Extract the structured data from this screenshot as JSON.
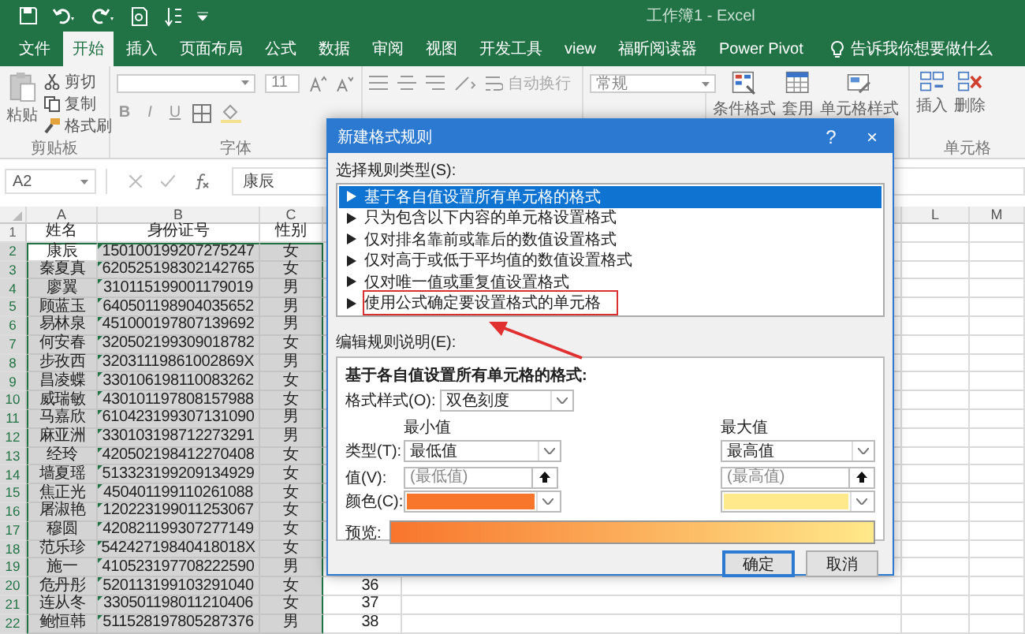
{
  "window": {
    "title": "工作簿1  -  Excel"
  },
  "menu_tabs": [
    {
      "label": "文件",
      "selected": false
    },
    {
      "label": "开始",
      "selected": true
    },
    {
      "label": "插入",
      "selected": false
    },
    {
      "label": "页面布局",
      "selected": false
    },
    {
      "label": "公式",
      "selected": false
    },
    {
      "label": "数据",
      "selected": false
    },
    {
      "label": "审阅",
      "selected": false
    },
    {
      "label": "视图",
      "selected": false
    },
    {
      "label": "开发工具",
      "selected": false
    },
    {
      "label": "view",
      "selected": false
    },
    {
      "label": "福昕阅读器",
      "selected": false
    },
    {
      "label": "Power Pivot",
      "selected": false
    }
  ],
  "tell_me": "告诉我你想要做什么",
  "ribbon": {
    "clipboard": {
      "paste": "粘贴",
      "cut": "剪切",
      "copy": "复制",
      "format_painter": "格式刷",
      "label": "剪贴板"
    },
    "font": {
      "size": "11",
      "bold": "B",
      "italic": "I",
      "underline": "U",
      "label": "字体"
    },
    "alignment": {
      "wrap_text": "自动换行"
    },
    "number": {
      "format": "常规"
    },
    "styles": {
      "conditional_formatting": "条件格式",
      "format_as_table": "套用",
      "cell_styles": "单元格样式"
    },
    "cells": {
      "insert": "插入",
      "delete": "删除",
      "label": "单元格"
    }
  },
  "formula_bar": {
    "name_box": "A2",
    "value": "康辰"
  },
  "sheet": {
    "column_headers": [
      "A",
      "B",
      "C",
      "L",
      "M"
    ],
    "rows": [
      {
        "number": "1",
        "cells": [
          "姓名",
          "身份证号",
          "性别"
        ],
        "selected": false,
        "active": false
      },
      {
        "number": "2",
        "cells": [
          "康辰",
          "150100199207275247",
          "女"
        ],
        "selected": true,
        "active": true
      },
      {
        "number": "3",
        "cells": [
          "秦夏真",
          "620525198302142765",
          "女"
        ],
        "selected": true,
        "active": false
      },
      {
        "number": "4",
        "cells": [
          "廖翼",
          "310115199001179019",
          "男"
        ],
        "selected": true,
        "active": false
      },
      {
        "number": "5",
        "cells": [
          "顾蓝玉",
          "640501198904035652",
          "男"
        ],
        "selected": true,
        "active": false
      },
      {
        "number": "6",
        "cells": [
          "易林泉",
          "451000197807139692",
          "男"
        ],
        "selected": true,
        "active": false
      },
      {
        "number": "7",
        "cells": [
          "何安春",
          "320502199309018782",
          "女"
        ],
        "selected": true,
        "active": false
      },
      {
        "number": "8",
        "cells": [
          "步孜西",
          "32031119861002869X",
          "男"
        ],
        "selected": true,
        "active": false
      },
      {
        "number": "9",
        "cells": [
          "昌凌蝶",
          "330106198110083262",
          "女"
        ],
        "selected": true,
        "active": false
      },
      {
        "number": "10",
        "cells": [
          "威瑞敏",
          "430101197808157988",
          "女"
        ],
        "selected": true,
        "active": false
      },
      {
        "number": "11",
        "cells": [
          "马嘉欣",
          "610423199307131090",
          "男"
        ],
        "selected": true,
        "active": false
      },
      {
        "number": "12",
        "cells": [
          "麻亚洲",
          "330103198712273291",
          "男"
        ],
        "selected": true,
        "active": false
      },
      {
        "number": "13",
        "cells": [
          "经玲",
          "420502198412270408",
          "女"
        ],
        "selected": true,
        "active": false
      },
      {
        "number": "14",
        "cells": [
          "墙夏瑶",
          "513323199209134929",
          "女"
        ],
        "selected": true,
        "active": false
      },
      {
        "number": "15",
        "cells": [
          "焦正光",
          "450401199110261088",
          "女"
        ],
        "selected": true,
        "active": false
      },
      {
        "number": "16",
        "cells": [
          "屠淑艳",
          "120223199011253067",
          "女"
        ],
        "selected": true,
        "active": false
      },
      {
        "number": "17",
        "cells": [
          "穆圆",
          "420821199307277149",
          "女"
        ],
        "selected": true,
        "active": false
      },
      {
        "number": "18",
        "cells": [
          "范乐珍",
          "54242719840418018X",
          "女"
        ],
        "selected": true,
        "active": false
      },
      {
        "number": "19",
        "cells": [
          "施一",
          "410523197708222590",
          "男"
        ],
        "selected": true,
        "active": false
      },
      {
        "number": "20",
        "cells": [
          "危丹彤",
          "520113199103291040",
          "女"
        ],
        "column_4": "36",
        "selected": true,
        "active": false
      },
      {
        "number": "21",
        "cells": [
          "连从冬",
          "330501198011210406",
          "女"
        ],
        "column_4": "37",
        "selected": true,
        "active": false
      },
      {
        "number": "22",
        "cells": [
          "鲍恒韩",
          "511528197805287376",
          "男"
        ],
        "column_4": "38",
        "selected": true,
        "active": false
      }
    ]
  },
  "dialog": {
    "title": "新建格式规则",
    "help": "?",
    "close": "×",
    "rule_type_label": "选择规则类型(S):",
    "rule_types": [
      {
        "label": "基于各自值设置所有单元格的格式",
        "selected": true,
        "highlighted": false
      },
      {
        "label": "只为包含以下内容的单元格设置格式",
        "selected": false,
        "highlighted": false
      },
      {
        "label": "仅对排名靠前或靠后的数值设置格式",
        "selected": false,
        "highlighted": false
      },
      {
        "label": "仅对高于或低于平均值的数值设置格式",
        "selected": false,
        "highlighted": false
      },
      {
        "label": "仅对唯一值或重复值设置格式",
        "selected": false,
        "highlighted": false
      },
      {
        "label": "使用公式确定要设置格式的单元格",
        "selected": false,
        "highlighted": true
      }
    ],
    "description_label": "编辑规则说明(E):",
    "description_heading": "基于各自值设置所有单元格的格式:",
    "format_style_label": "格式样式(O):",
    "format_style": "双色刻度",
    "type_label": "类型(T):",
    "value_label": "值(V):",
    "color_label": "颜色(C):",
    "scale_points": [
      {
        "heading": "最小值",
        "type": "最低值",
        "value_placeholder": "(最低值)",
        "color": "#f8752c"
      },
      {
        "heading": "最大值",
        "type": "最高值",
        "value_placeholder": "(最高值)",
        "color": "#ffe98a"
      }
    ],
    "preview_label": "预览:",
    "buttons": [
      {
        "label": "确定",
        "default": true
      },
      {
        "label": "取消",
        "default": false
      }
    ]
  }
}
